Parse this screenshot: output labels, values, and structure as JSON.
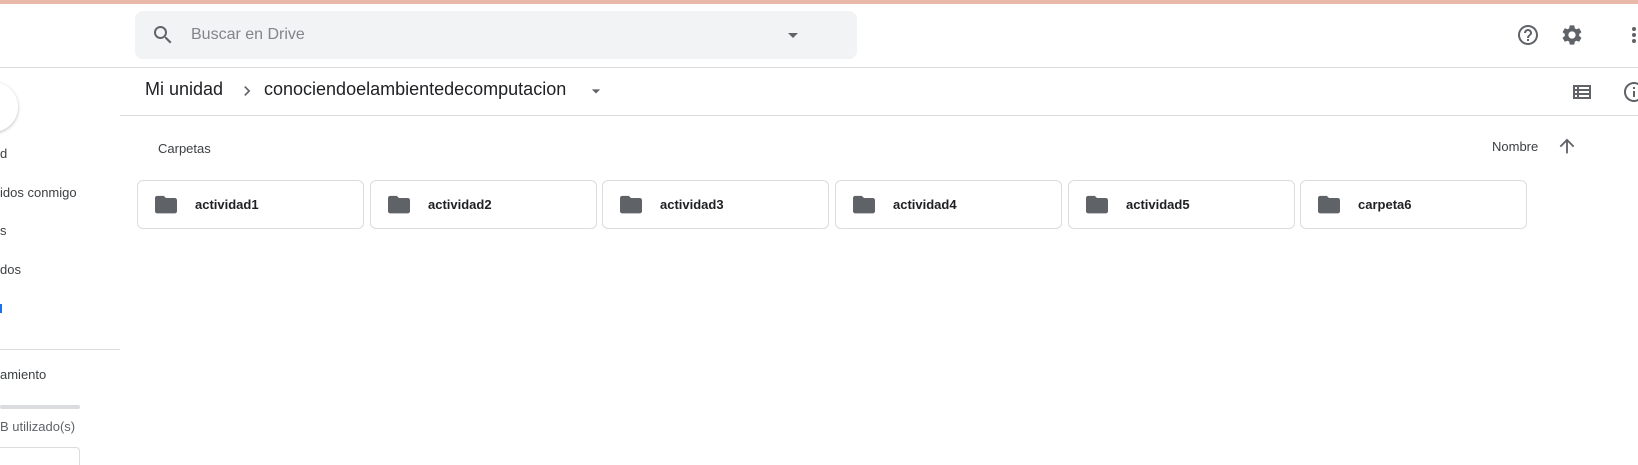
{
  "header": {
    "search_placeholder": "Buscar en Drive"
  },
  "sidebar": {
    "items": [
      {
        "label": "d",
        "active": false
      },
      {
        "label": "idos conmigo",
        "active": false
      },
      {
        "label": "s",
        "active": false
      },
      {
        "label": "dos",
        "active": false
      },
      {
        "label": "…",
        "active": true
      }
    ],
    "storage": {
      "title": "amiento",
      "used_text": "B utilizado(s)"
    }
  },
  "breadcrumb": {
    "root": "Mi unidad",
    "current": "conociendoelambientedecomputacion"
  },
  "main": {
    "section_title": "Carpetas",
    "sort_label": "Nombre",
    "folders": [
      {
        "name": "actividad1"
      },
      {
        "name": "actividad2"
      },
      {
        "name": "actividad3"
      },
      {
        "name": "actividad4"
      },
      {
        "name": "actividad5"
      },
      {
        "name": "carpeta6"
      }
    ]
  },
  "colors": {
    "accent": "#1a73e8",
    "icon": "#5f6368",
    "border": "#dadce0",
    "search_bg": "#f1f3f4"
  },
  "icons": [
    "search-icon",
    "chevron-down-icon",
    "help-icon",
    "gear-icon",
    "more-vert-icon",
    "chevron-right-icon",
    "list-view-icon",
    "info-icon",
    "arrow-up-icon",
    "folder-icon"
  ]
}
